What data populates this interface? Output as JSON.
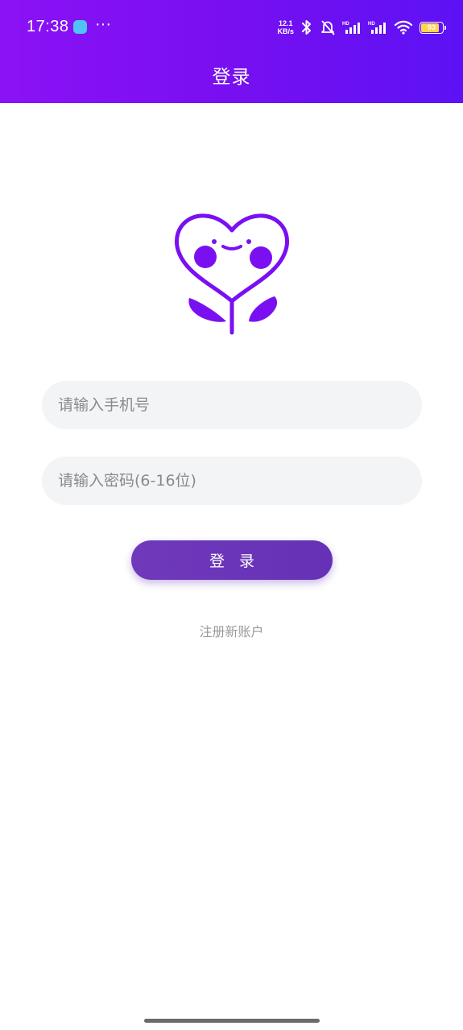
{
  "status_bar": {
    "time": "17:38",
    "dots": "···",
    "net_speed_value": "12.1",
    "net_speed_unit": "KB/s",
    "battery": "93"
  },
  "header": {
    "title": "登录"
  },
  "form": {
    "phone_placeholder": "请输入手机号",
    "password_placeholder": "请输入密码(6-16位)",
    "login_label": "登 录",
    "register_label": "注册新账户"
  },
  "colors": {
    "header_gradient_start": "#8B12F5",
    "header_gradient_end": "#5C12F5",
    "logo_purple": "#7A10F2",
    "button_purple": "#6A35B8",
    "input_bg": "#F3F4F6"
  }
}
